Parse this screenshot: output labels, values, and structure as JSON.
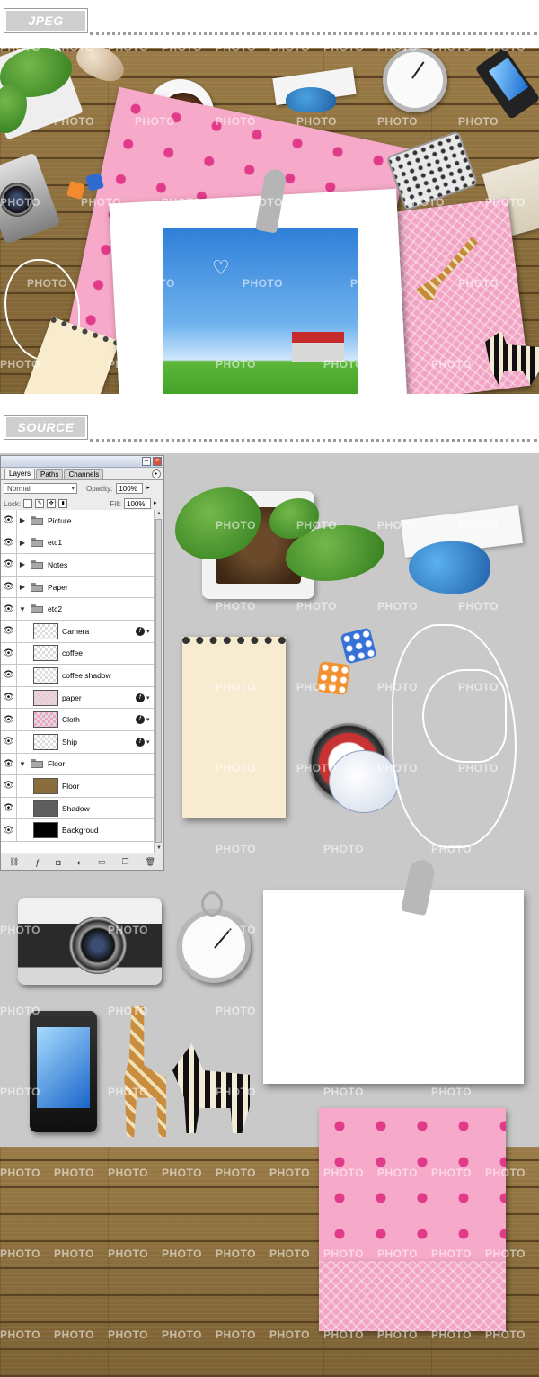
{
  "headers": {
    "jpeg_label": "JPEG",
    "source_label": "SOURCE"
  },
  "watermark_text": "PHOTO",
  "layers_panel": {
    "tabs": [
      "Layers",
      "Paths",
      "Channels"
    ],
    "blend_mode": "Normal",
    "opacity_label": "Opacity:",
    "opacity_value": "100%",
    "lock_label": "Lock:",
    "fill_label": "Fill:",
    "fill_value": "100%",
    "layers": [
      {
        "name": "Picture",
        "kind": "group",
        "indent": 0,
        "expanded": false
      },
      {
        "name": "etc1",
        "kind": "group",
        "indent": 0,
        "expanded": false
      },
      {
        "name": "Notes",
        "kind": "group",
        "indent": 0,
        "expanded": false
      },
      {
        "name": "Paper",
        "kind": "group",
        "indent": 0,
        "expanded": false
      },
      {
        "name": "etc2",
        "kind": "group",
        "indent": 0,
        "expanded": true
      },
      {
        "name": "Camera",
        "kind": "layer",
        "fx": true
      },
      {
        "name": "coffee",
        "kind": "layer",
        "fx": false
      },
      {
        "name": "coffee shadow",
        "kind": "layer",
        "fx": false
      },
      {
        "name": "paper",
        "kind": "layer",
        "fx": true
      },
      {
        "name": "Cloth",
        "kind": "layer",
        "fx": true
      },
      {
        "name": "Ship",
        "kind": "layer",
        "fx": true
      },
      {
        "name": "Floor",
        "kind": "group",
        "indent": 0,
        "expanded": true
      },
      {
        "name": "Floor",
        "kind": "layer",
        "fx": false
      },
      {
        "name": "Shadow",
        "kind": "layer",
        "fx": false
      },
      {
        "name": "Backgroud",
        "kind": "layer",
        "fx": false
      }
    ]
  },
  "colors": {
    "wood": "#8a6d3b",
    "pink_paper": "#f6a9c9",
    "pink_dot": "#e23a8a",
    "source_bg": "#c9c9c9"
  }
}
